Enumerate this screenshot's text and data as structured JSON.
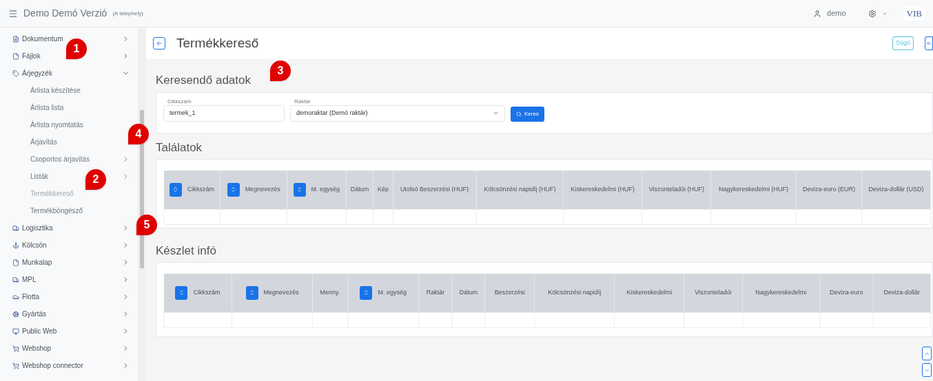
{
  "topbar": {
    "app_title": "Demo Demó Verzió",
    "site": "(A telephely)",
    "user": "demo",
    "logo_text": "VIB"
  },
  "sidebar": {
    "items": [
      {
        "kind": "item",
        "label": "Dokumentum",
        "has_children": true,
        "expanded": false,
        "selected": false
      },
      {
        "kind": "item",
        "label": "Fájlok",
        "has_children": true,
        "expanded": false,
        "selected": false
      },
      {
        "kind": "item",
        "label": "Árjegyzék",
        "has_children": true,
        "expanded": true,
        "selected": false
      },
      {
        "kind": "sub",
        "label": "Árlista készítése",
        "has_children": false,
        "selected": false
      },
      {
        "kind": "sub",
        "label": "Árlista lista",
        "has_children": false,
        "selected": false
      },
      {
        "kind": "sub",
        "label": "Árlista nyomtatás",
        "has_children": false,
        "selected": false
      },
      {
        "kind": "sub",
        "label": "Árjavítás",
        "has_children": false,
        "selected": false
      },
      {
        "kind": "sub",
        "label": "Csoportos árjavítás",
        "has_children": true,
        "selected": false
      },
      {
        "kind": "sub",
        "label": "Listák",
        "has_children": true,
        "selected": false
      },
      {
        "kind": "sub",
        "label": "Termékkereső",
        "has_children": false,
        "selected": true
      },
      {
        "kind": "sub",
        "label": "Termékböngésző",
        "has_children": false,
        "selected": false
      },
      {
        "kind": "item",
        "label": "Logisztika",
        "has_children": true,
        "expanded": false,
        "selected": false
      },
      {
        "kind": "item",
        "label": "Kölcsön",
        "has_children": true,
        "expanded": false,
        "selected": false
      },
      {
        "kind": "item",
        "label": "Munkalap",
        "has_children": true,
        "expanded": false,
        "selected": false
      },
      {
        "kind": "item",
        "label": "MPL",
        "has_children": true,
        "expanded": false,
        "selected": false
      },
      {
        "kind": "item",
        "label": "Flotta",
        "has_children": true,
        "expanded": false,
        "selected": false
      },
      {
        "kind": "item",
        "label": "Gyártás",
        "has_children": true,
        "expanded": false,
        "selected": false
      },
      {
        "kind": "item",
        "label": "Public Web",
        "has_children": true,
        "expanded": false,
        "selected": false
      },
      {
        "kind": "item",
        "label": "Webshop",
        "has_children": true,
        "expanded": false,
        "selected": false
      },
      {
        "kind": "item",
        "label": "Webshop connector",
        "has_children": true,
        "expanded": false,
        "selected": false
      }
    ]
  },
  "page": {
    "title": "Termékkereső",
    "help_button": "Súgó"
  },
  "search_section": {
    "heading": "Keresendő adatok",
    "fields": [
      {
        "kind": "text",
        "label": "Cikkszám",
        "value": "termek_1"
      },
      {
        "kind": "select",
        "label": "Raktár",
        "value": "demoraktar (Demó raktár)"
      }
    ],
    "button": "Keres"
  },
  "results": {
    "heading": "Találatok",
    "columns": [
      {
        "label": "Cikkszám",
        "sortable": true
      },
      {
        "label": "Megnevezés",
        "sortable": true
      },
      {
        "label": "M. egység",
        "sortable": true
      },
      {
        "label": "Dátum",
        "sortable": false
      },
      {
        "label": "Kép",
        "sortable": false
      },
      {
        "label": "Utolsó Beszerzési (HUF)",
        "sortable": false
      },
      {
        "label": "Kölcsönzési napidíj (HUF)",
        "sortable": false
      },
      {
        "label": "Kiskereskedelmi (HUF)",
        "sortable": false
      },
      {
        "label": "Viszonteladói (HUF)",
        "sortable": false
      },
      {
        "label": "Nagykereskedelmi (HUF)",
        "sortable": false
      },
      {
        "label": "Deviza-euro (EUR)",
        "sortable": false
      },
      {
        "label": "Deviza-dollár (USD)",
        "sortable": false
      }
    ]
  },
  "stock": {
    "heading": "Készlet infó",
    "columns": [
      {
        "label": "Cikkszám",
        "sortable": true
      },
      {
        "label": "Megnevezés",
        "sortable": true
      },
      {
        "label": "Menny.",
        "sortable": false
      },
      {
        "label": "M. egység",
        "sortable": true
      },
      {
        "label": "Raktár",
        "sortable": false
      },
      {
        "label": "Dátum",
        "sortable": false
      },
      {
        "label": "Beszerzési",
        "sortable": false
      },
      {
        "label": "Kölcsönzési napidíj",
        "sortable": false
      },
      {
        "label": "Kiskereskedelmi",
        "sortable": false
      },
      {
        "label": "Viszonteladói",
        "sortable": false
      },
      {
        "label": "Nagykereskedelmi",
        "sortable": false
      },
      {
        "label": "Deviza-euro",
        "sortable": false
      },
      {
        "label": "Deviza-dollár",
        "sortable": false
      }
    ]
  },
  "callouts": [
    "1",
    "2",
    "3",
    "4",
    "5"
  ]
}
